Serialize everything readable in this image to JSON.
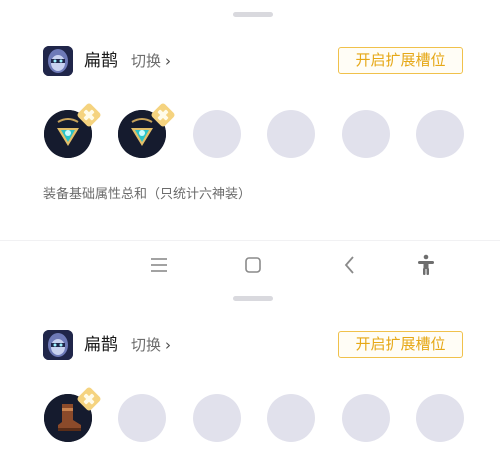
{
  "panels": [
    {
      "hero_name": "扁鹊",
      "switch_label": "切换",
      "expand_button": "开启扩展槽位",
      "summary": "装备基础属性总和（只统计六神装）",
      "slots": [
        "amulet-icon",
        "amulet-icon",
        "empty",
        "empty",
        "empty",
        "empty"
      ]
    },
    {
      "hero_name": "扁鹊",
      "switch_label": "切换",
      "expand_button": "开启扩展槽位",
      "slots": [
        "boots-icon",
        "empty",
        "empty",
        "empty",
        "empty",
        "empty"
      ]
    }
  ],
  "navbar": {
    "items": [
      "menu-icon",
      "home-icon",
      "back-icon",
      "accessibility-icon"
    ]
  },
  "colors": {
    "accent": "#e6a817",
    "slot_empty": "#e1e1ec"
  }
}
